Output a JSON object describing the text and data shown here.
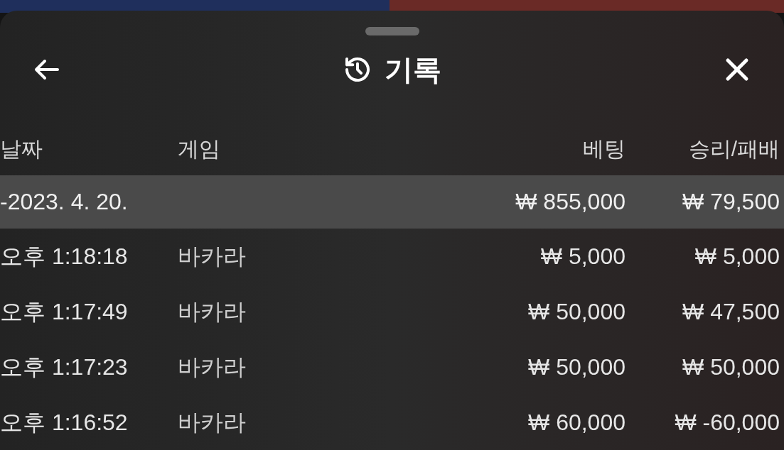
{
  "sheet": {
    "title": "기록"
  },
  "table": {
    "columns": [
      "날짜",
      "게임",
      "베팅",
      "승리/패배"
    ],
    "group": {
      "date": "-2023. 4. 20.",
      "bet": "₩ 855,000",
      "result": "₩ 79,500",
      "selected": true
    },
    "rows": [
      {
        "time": "오후 1:18:18",
        "game": "바카라",
        "bet": "₩ 5,000",
        "result": "₩ 5,000"
      },
      {
        "time": "오후 1:17:49",
        "game": "바카라",
        "bet": "₩ 50,000",
        "result": "₩ 47,500"
      },
      {
        "time": "오후 1:17:23",
        "game": "바카라",
        "bet": "₩ 50,000",
        "result": "₩ 50,000"
      },
      {
        "time": "오후 1:16:52",
        "game": "바카라",
        "bet": "₩ 60,000",
        "result": "₩ -60,000"
      }
    ]
  }
}
